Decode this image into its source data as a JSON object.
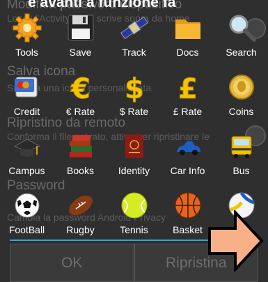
{
  "dialog": {
    "top_fragment": "e avanti a funzione fa"
  },
  "background": {
    "sections": [
      {
        "head": "Modifica password dispositivo",
        "sub": "Locali l'Activity e poi scrive sopra da home"
      },
      {
        "head": "Salva icona",
        "sub": "Stampa una icona personalizzata"
      },
      {
        "head": "Ripristino da remoto",
        "sub": "Conforma il file salvato, attivo per ripristinare le"
      },
      {
        "head": "Password",
        "sub": "Cambia la password Android Privacy"
      }
    ]
  },
  "grid": {
    "rows": [
      [
        {
          "label": "Tools",
          "icon": "gear-icon"
        },
        {
          "label": "Save",
          "icon": "floppy-icon"
        },
        {
          "label": "Track",
          "icon": "satellite-icon"
        },
        {
          "label": "Docs",
          "icon": "folder-icon"
        },
        {
          "label": "Search",
          "icon": "magnifier-icon"
        }
      ],
      [
        {
          "label": "Credit",
          "icon": "credit-card-icon"
        },
        {
          "label": "€ Rate",
          "icon": "euro-icon"
        },
        {
          "label": "$ Rate",
          "icon": "dollar-icon"
        },
        {
          "label": "£ Rate",
          "icon": "pound-icon"
        },
        {
          "label": "Coins",
          "icon": "coin-icon"
        }
      ],
      [
        {
          "label": "Campus",
          "icon": "graduation-cap-icon"
        },
        {
          "label": "Books",
          "icon": "books-icon"
        },
        {
          "label": "Identity",
          "icon": "passport-icon"
        },
        {
          "label": "Car Info",
          "icon": "car-icon"
        },
        {
          "label": "Bus",
          "icon": "bus-icon"
        }
      ],
      [
        {
          "label": "FootBall",
          "icon": "soccer-ball-icon"
        },
        {
          "label": "Rugby",
          "icon": "rugby-ball-icon"
        },
        {
          "label": "Tennis",
          "icon": "tennis-ball-icon"
        },
        {
          "label": "Basket",
          "icon": "basketball-icon"
        },
        {
          "label": "",
          "icon": "volleyball-icon"
        }
      ]
    ]
  },
  "buttons": {
    "ok": "OK",
    "restore": "Ripristina"
  },
  "colors": {
    "accent": "#2fa8d8",
    "arrow_fill": "#f8b088",
    "arrow_stroke": "#000000"
  }
}
